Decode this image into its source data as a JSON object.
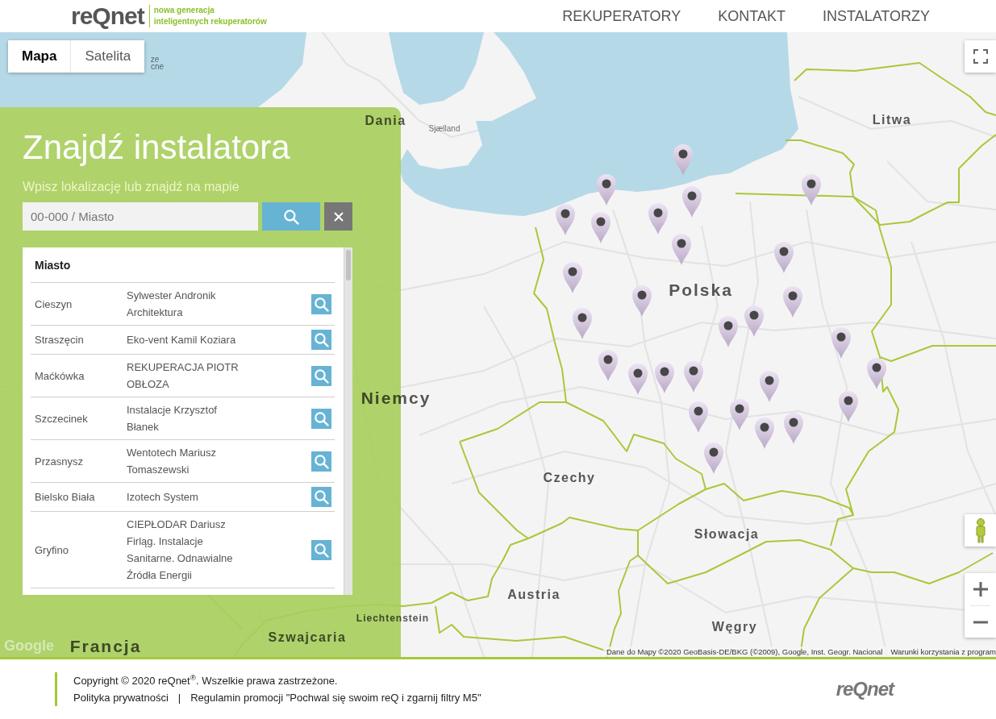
{
  "header": {
    "logo": "reQnet",
    "tagline": [
      "nowa generacja",
      "inteligentnych rekuperatorów"
    ],
    "nav": [
      {
        "label": "REKUPERATORY"
      },
      {
        "label": "KONTAKT"
      },
      {
        "label": "INSTALATORZY"
      }
    ]
  },
  "map": {
    "type_buttons": [
      {
        "label": "Mapa",
        "selected": true
      },
      {
        "label": "Satelita",
        "selected": false
      }
    ],
    "labels": [
      {
        "text": "ze",
        "kind": "place"
      },
      {
        "text": "cne",
        "kind": "place"
      },
      {
        "text": "Dania",
        "kind": "country"
      },
      {
        "text": "Litwa",
        "kind": "country"
      },
      {
        "text": "Sjælland",
        "kind": "place"
      },
      {
        "text": "Polska",
        "kind": "large"
      },
      {
        "text": "Niemcy",
        "kind": "large"
      },
      {
        "text": "Czechy",
        "kind": "country"
      },
      {
        "text": "Słowacja",
        "kind": "country"
      },
      {
        "text": "Austria",
        "kind": "country"
      },
      {
        "text": "Liechtenstein",
        "kind": "small"
      },
      {
        "text": "Węgry",
        "kind": "country"
      },
      {
        "text": "Szwajcaria",
        "kind": "country"
      },
      {
        "text": "Francja",
        "kind": "large"
      }
    ],
    "logo": "Google",
    "attribution": "Dane do Mapy ©2020 GeoBasis-DE/BKG (©2009), Google, Inst. Geogr. Nacional",
    "terms_link": "Warunki korzystania z program"
  },
  "finder": {
    "title": "Znajdź instalatora",
    "subtitle": "Wpisz lokalizację lub znajdź na mapie",
    "search": {
      "placeholder": "00-000 / Miasto"
    },
    "table": {
      "columns": [
        "Miasto"
      ],
      "rows": [
        {
          "city": "Cieszyn",
          "name": "Sylwester Andronik Architektura"
        },
        {
          "city": "Straszęcin",
          "name": "Eko-vent Kamil Koziara"
        },
        {
          "city": "Maćkówka",
          "name": "REKUPERACJA PIOTR OBŁOZA"
        },
        {
          "city": "Szczecinek",
          "name": "Instalacje Krzysztof Błanek"
        },
        {
          "city": "Przasnysz",
          "name": "Wentotech Mariusz Tomaszewski"
        },
        {
          "city": "Bielsko Biała",
          "name": "Izotech System"
        },
        {
          "city": "Gryfino",
          "name": "CIEPŁODAR Dariusz Firląg. Instalacje Sanitarne. Odnawialne Źródła Energii"
        }
      ]
    }
  },
  "footer": {
    "copyright": "Copyright © 2020 reQnet$^{®}$. Wszelkie prawa zastrzeżone.",
    "links": [
      "Polityka prywatności",
      "Regulamin promocji \"Pochwal się swoim reQ i zgarnij filtry M5\""
    ],
    "separator": "|",
    "logo": "reQnet"
  }
}
